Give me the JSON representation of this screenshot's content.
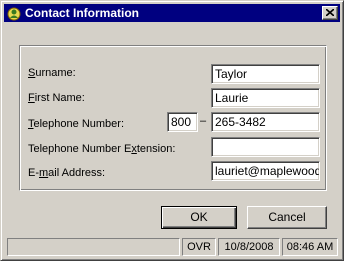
{
  "window": {
    "title": "Contact Information",
    "close_symbol": "×"
  },
  "form": {
    "surname": {
      "label_access": "S",
      "label_rest": "urname:",
      "value": "Taylor"
    },
    "first_name": {
      "label_access": "F",
      "label_rest": "irst Name:",
      "value": "Laurie"
    },
    "telephone": {
      "label_access": "T",
      "label_rest": "elephone Number:",
      "area_code": "800",
      "separator": "–",
      "number": "265-3482"
    },
    "extension": {
      "label_pre": "Telephone Number E",
      "label_access": "x",
      "label_rest": "tension:",
      "value": ""
    },
    "email": {
      "label_pre": "E-",
      "label_access": "m",
      "label_rest": "ail Address:",
      "value": "lauriet@maplewood.c"
    }
  },
  "buttons": {
    "ok": "OK",
    "cancel": "Cancel"
  },
  "statusbar": {
    "message": "",
    "mode": "OVR",
    "date": "10/8/2008",
    "time": "08:46 AM"
  },
  "icons": {
    "app": "app-contact-icon",
    "close": "close-icon"
  }
}
